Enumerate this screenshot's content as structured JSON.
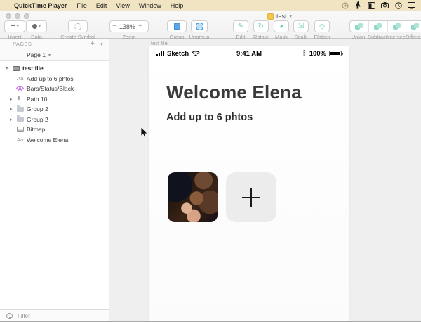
{
  "menubar": {
    "apple": "",
    "app_name": "QuickTime Player",
    "menus": [
      "File",
      "Edit",
      "View",
      "Window",
      "Help"
    ],
    "status_icons": [
      "record-icon",
      "pointer-icon",
      "contrast-icon",
      "camera-icon",
      "clock-icon",
      "display-icon"
    ]
  },
  "window": {
    "doc_title": "test"
  },
  "toolbar": {
    "insert_label": "Insert",
    "data_label": "Data",
    "create_symbol_label": "Create Symbol",
    "zoom_label": "Zoom",
    "zoom_value": "138%",
    "zoom_minus": "−",
    "zoom_plus": "+",
    "group_label": "Group",
    "ungroup_label": "Ungroup",
    "edit_label": "Edit",
    "rotate_label": "Rotate",
    "mask_label": "Mask",
    "scale_label": "Scale",
    "flatten_label": "Flatten",
    "union_label": "Union",
    "subtract_label": "Subtract",
    "intersect_label": "Intersect",
    "difference_label": "Difference"
  },
  "sidebar": {
    "pages_header": "PAGES",
    "page_name": "Page 1",
    "text_icon_glyph": "Aa",
    "layers": [
      {
        "name": "test file",
        "icon": "artboard-icon"
      },
      {
        "name": "Add up to 6 phtos",
        "icon": "text-icon"
      },
      {
        "name": "Bars/Status/Black",
        "icon": "symbol-icon"
      },
      {
        "name": "Path 10",
        "icon": "path-icon"
      },
      {
        "name": "Group 2",
        "icon": "folder-icon"
      },
      {
        "name": "Group 2",
        "icon": "folder-icon"
      },
      {
        "name": "Bitmap",
        "icon": "bitmap-icon"
      },
      {
        "name": "Welcome Elena",
        "icon": "text-icon"
      }
    ],
    "filter_label": "Filter"
  },
  "canvas": {
    "artboard_label": "test file",
    "status_bar": {
      "carrier": "Sketch",
      "time": "9:41 AM",
      "battery_pct": "100%",
      "bluetooth_glyph": "ᛒ"
    },
    "heading": "Welcome Elena",
    "subheading": "Add up to 6 phtos"
  },
  "colors": {
    "menubar_bg": "#F1E4C3",
    "accent_mint": "#8ED6C4",
    "accent_blue": "#5AA7E8",
    "symbol_purple": "#C05AE0",
    "canvas_bg": "#EFEFEF",
    "heading_text": "#3A3A3A"
  }
}
